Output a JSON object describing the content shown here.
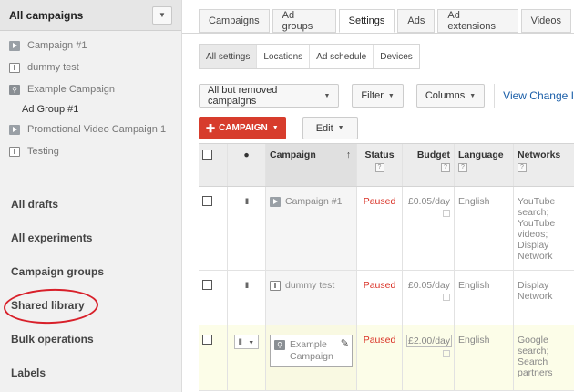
{
  "sidebar": {
    "header_title": "All campaigns",
    "items": [
      {
        "icon": "video-icon",
        "label": "Campaign #1"
      },
      {
        "icon": "text-ad-icon",
        "label": "dummy test"
      },
      {
        "icon": "search-icon",
        "label": "Example Campaign"
      },
      {
        "icon": "",
        "label": "Ad Group #1",
        "sub": true
      },
      {
        "icon": "video-icon",
        "label": "Promotional Video Campaign 1"
      },
      {
        "icon": "text-ad-icon",
        "label": "Testing"
      }
    ],
    "sections": [
      "All drafts",
      "All experiments",
      "Campaign groups",
      "Shared library",
      "Bulk operations",
      "Labels"
    ]
  },
  "tabs": [
    "Campaigns",
    "Ad groups",
    "Settings",
    "Ads",
    "Ad extensions",
    "Videos"
  ],
  "active_tab": "Settings",
  "subtabs": [
    "All settings",
    "Locations",
    "Ad schedule",
    "Devices"
  ],
  "active_subtab": "All settings",
  "toolbar": {
    "filter_scope": "All but removed campaigns",
    "filter": "Filter",
    "columns": "Columns",
    "view_change": "View Change I"
  },
  "actions": {
    "campaign_button": "CAMPAIGN",
    "edit_button": "Edit"
  },
  "table": {
    "headers": {
      "campaign": "Campaign",
      "status": "Status",
      "budget": "Budget",
      "language": "Language",
      "networks": "Networks",
      "help": "?"
    },
    "rows": [
      {
        "campaign": "Campaign #1",
        "status": "Paused",
        "budget": "£0.05/day",
        "language": "English",
        "networks": [
          "YouTube",
          "search;",
          "YouTube",
          "videos;",
          "Display",
          "Network"
        ]
      },
      {
        "campaign": "dummy test",
        "status": "Paused",
        "budget": "£0.05/day",
        "language": "English",
        "networks": [
          "Display",
          "Network"
        ]
      },
      {
        "campaign": "Example Campaign",
        "status": "Paused",
        "budget": "£2.00/day",
        "language": "English",
        "networks": [
          "Google",
          "search;",
          "Search",
          "partners"
        ]
      }
    ]
  },
  "colors": {
    "accent_red": "#d73c2c",
    "paused_red": "#d93025",
    "link_blue": "#1a5ea8",
    "annotation_circle": "#d8202a"
  }
}
